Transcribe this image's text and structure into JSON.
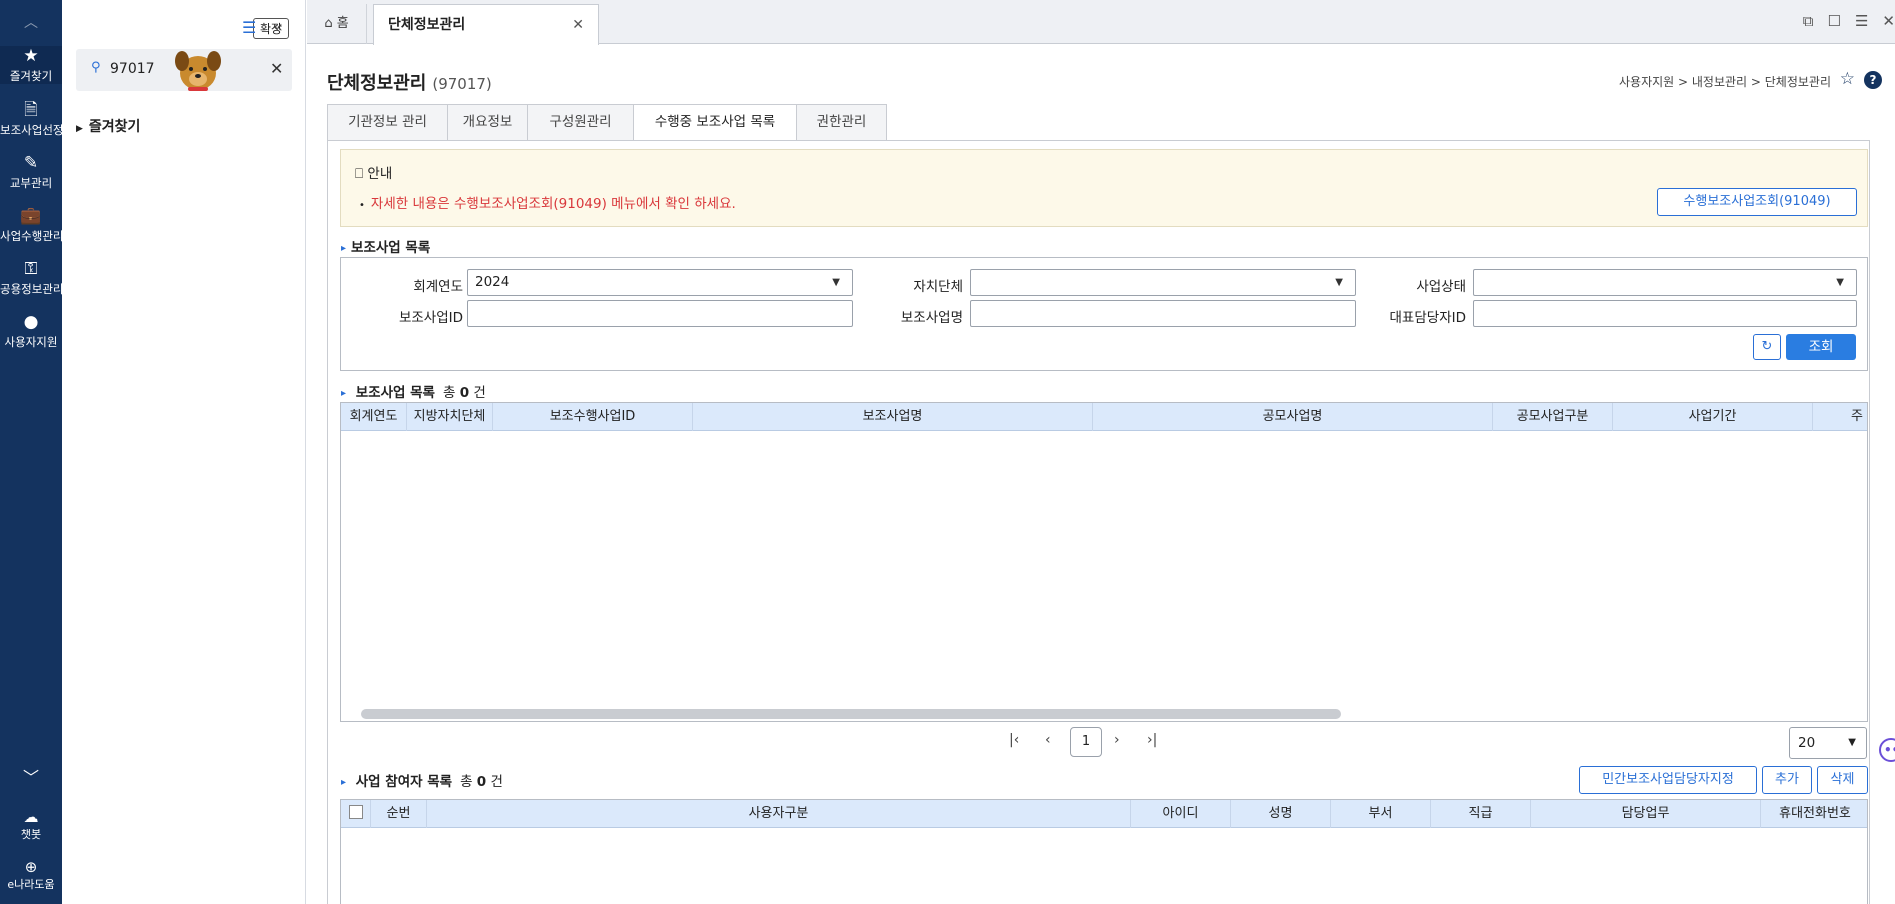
{
  "rail": {
    "items": [
      {
        "icon": "★",
        "label": "즐겨찾기"
      },
      {
        "icon": "🗎",
        "label": "보조사업선정"
      },
      {
        "icon": "✎",
        "label": "교부관리"
      },
      {
        "icon": "💼",
        "label": "사업수행관리"
      },
      {
        "icon": "⚿",
        "label": "공용정보관리"
      },
      {
        "icon": "●",
        "label": "사용자지원"
      }
    ],
    "chatbot_label": "챗봇",
    "help_label": "e나라도움"
  },
  "panel": {
    "expand_label": "확장",
    "search_value": "97017",
    "tree_root": "즐겨찾기"
  },
  "topbar": {
    "home_tab": "홈",
    "active_tab": "단체정보관리"
  },
  "page": {
    "title": "단체정보관리",
    "title_code": "(97017)",
    "breadcrumb": "사용자지원 > 내정보관리 > 단체정보관리",
    "subtabs": [
      "기관정보 관리",
      "개요정보",
      "구성원관리",
      "수행중 보조사업 목록",
      "권한관리"
    ],
    "active_subtab": "수행중 보조사업 목록"
  },
  "notice": {
    "heading": "안내",
    "text": "자세한 내용은 수행보조사업조회(91049) 메뉴에서 확인 하세요.",
    "button": "수행보조사업조회(91049)"
  },
  "filter": {
    "section": "보조사업 목록",
    "fields": [
      {
        "label": "회계연도",
        "value": "2024"
      },
      {
        "label": "자치단체",
        "value": ""
      },
      {
        "label": "사업상태",
        "value": ""
      },
      {
        "label": "보조사업ID",
        "value": ""
      },
      {
        "label": "보조사업명",
        "value": ""
      },
      {
        "label": "대표담당자ID",
        "value": ""
      }
    ],
    "search_button": "조회"
  },
  "list": {
    "section": "보조사업 목록",
    "count_prefix": "총",
    "count": "0",
    "count_suffix": "건",
    "columns": [
      "회계연도",
      "지방자치단체",
      "보조수행사업ID",
      "보조사업명",
      "공모사업명",
      "공모사업구분",
      "사업기간",
      "주"
    ],
    "page": "1",
    "page_size": "20"
  },
  "participants": {
    "section": "사업 참여자 목록",
    "count_prefix": "총",
    "count": "0",
    "count_suffix": "건",
    "btn_assign": "민간보조사업담당자지정",
    "btn_add": "추가",
    "btn_delete": "삭제",
    "columns": [
      "순번",
      "사용자구분",
      "아이디",
      "성명",
      "부서",
      "직급",
      "담당업무",
      "휴대전화번호"
    ]
  }
}
